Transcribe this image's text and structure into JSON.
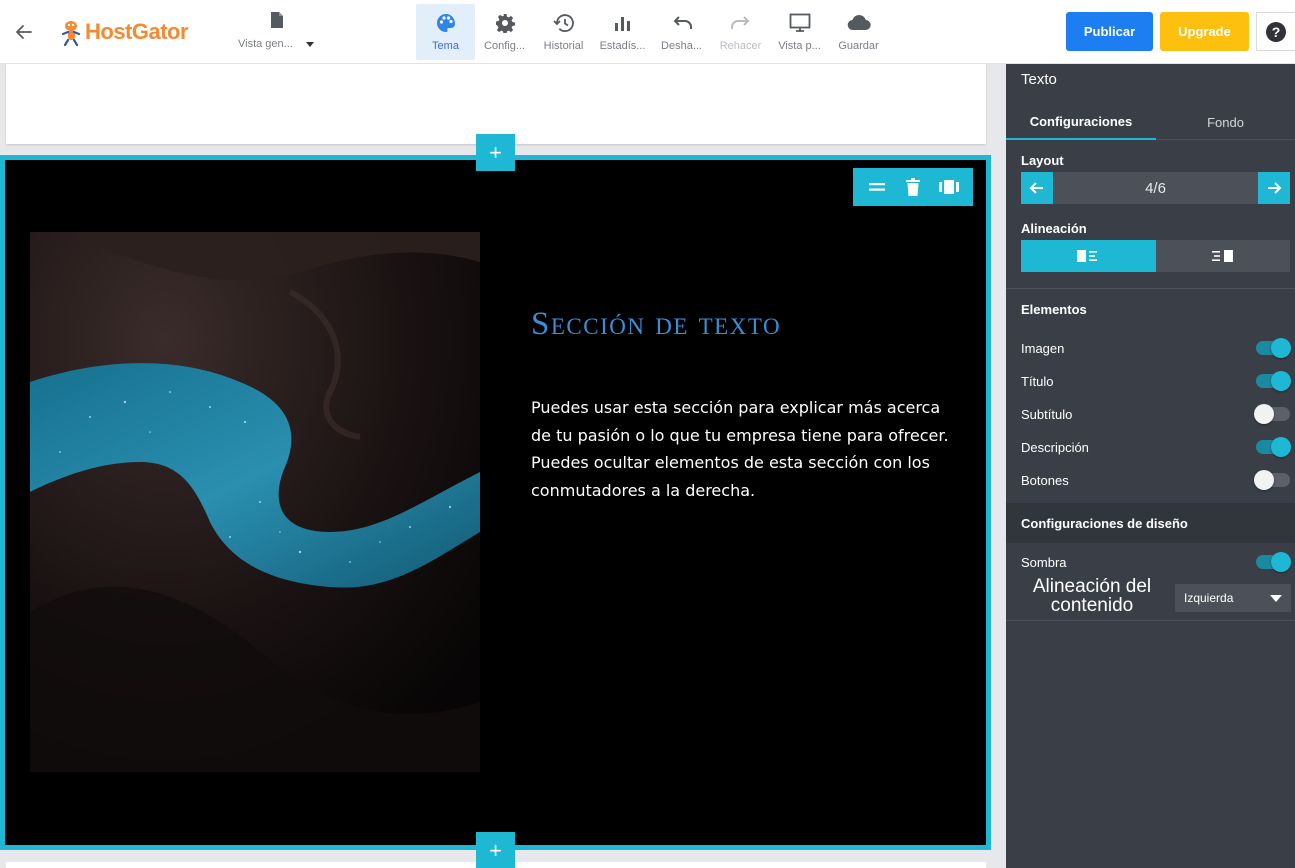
{
  "app": {
    "brand": "HostGator",
    "page_select_label": "Vista gen...",
    "brand_color": "#f68a33",
    "accent_color": "#1fb8d4"
  },
  "toolbar": {
    "tools": [
      {
        "label": "Tema",
        "icon": "palette-icon",
        "active": true
      },
      {
        "label": "Config...",
        "icon": "gear-icon"
      },
      {
        "label": "Historial",
        "icon": "history-icon"
      },
      {
        "label": "Estadís...",
        "icon": "bar-chart-icon"
      },
      {
        "label": "Desha...",
        "icon": "undo-icon"
      },
      {
        "label": "Rehacer",
        "icon": "redo-icon",
        "disabled": true
      },
      {
        "label": "Vista p...",
        "icon": "monitor-icon"
      },
      {
        "label": "Guardar",
        "icon": "cloud-icon"
      }
    ],
    "publish_label": "Publicar",
    "upgrade_label": "Upgrade",
    "help_label": "?"
  },
  "canvas": {
    "section_title": "Sección de texto",
    "description": [
      "Puedes usar esta sección para explicar más acerca de tu pasión o lo que tu empresa tiene para ofrecer.",
      "Puedes ocultar elementos de esta sección con los conmutadores a la derecha."
    ],
    "add_section_label": "+"
  },
  "panel": {
    "title": "Texto",
    "tabs": [
      "Configuraciones",
      "Fondo"
    ],
    "layout_label": "Layout",
    "layout_value": "4/6",
    "alignment_label": "Alineación",
    "elements_label": "Elementos",
    "elements": [
      {
        "label": "Imagen",
        "on": true
      },
      {
        "label": "Título",
        "on": true
      },
      {
        "label": "Subtítulo",
        "on": false
      },
      {
        "label": "Descripción",
        "on": true
      },
      {
        "label": "Botones",
        "on": false
      }
    ],
    "design_label": "Configuraciones de diseño",
    "shadow_label": "Sombra",
    "shadow_on": true,
    "content_align_label": "Alineación del contenido",
    "content_align_value": "Izquierda"
  }
}
